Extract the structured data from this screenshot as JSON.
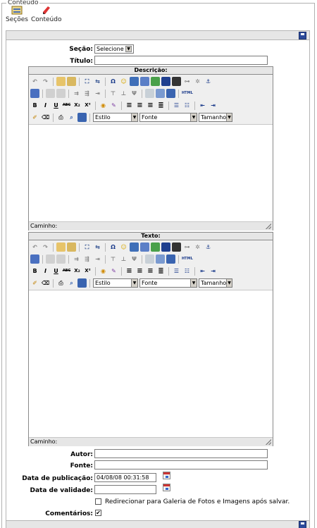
{
  "legend": "Conteúdo",
  "top_buttons": {
    "sections": "Seções",
    "content": "Conteúdo"
  },
  "form": {
    "secao_label": "Seção:",
    "secao_value": "Selecione",
    "titulo_label": "Título:",
    "titulo_value": "",
    "autor_label": "Autor:",
    "autor_value": "",
    "fonte_label": "Fonte:",
    "fonte_value": "",
    "pub_label": "Data de publicação:",
    "pub_value": "04/08/08 00:31:58",
    "val_label": "Data de validade:",
    "val_value": "",
    "redirect_label": "Redirecionar para Galeria de Fotos e Imagens após salvar.",
    "coment_label": "Comentários:",
    "coment_checked": "✔"
  },
  "editors": {
    "descricao_title": "Descrição:",
    "texto_title": "Texto:",
    "path_label": "Caminho:",
    "style_select": "Estilo",
    "font_select": "Fonte",
    "size_select": "Tamanho",
    "html_btn": "HTML",
    "bold": "B",
    "italic": "I",
    "underline": "U",
    "strike": "ABC",
    "sub": "X₂",
    "sup": "X²",
    "omega": "Ω",
    "anchor": "⚓"
  }
}
